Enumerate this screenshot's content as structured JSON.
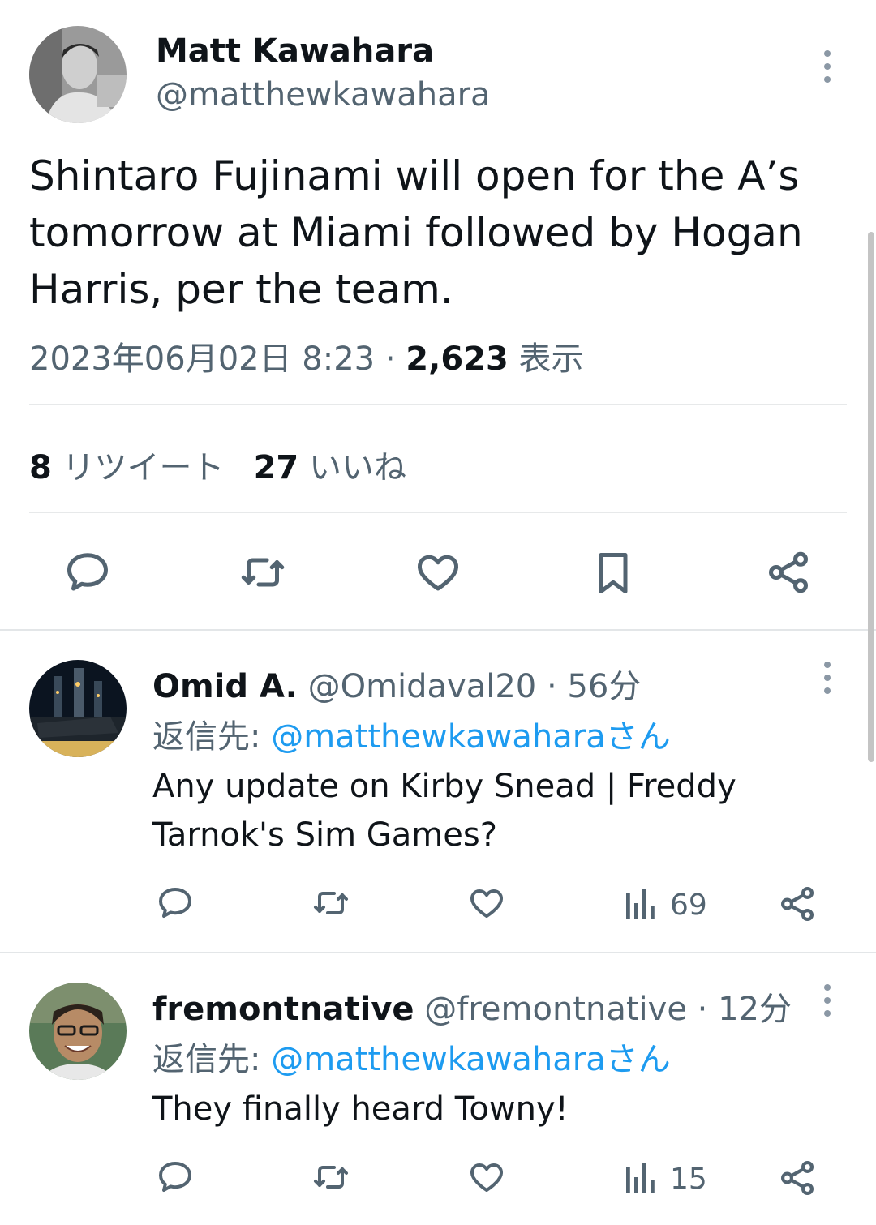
{
  "main_tweet": {
    "author_name": "Matt Kawahara",
    "author_handle": "@matthewkawahara",
    "text": "Shintaro Fujinami will open for the A’s tomorrow at Miami followed by Hogan Harris, per the team.",
    "date": "2023年06月02日 8:23",
    "separator": "·",
    "views_count": "2,623",
    "views_label": "表示",
    "retweets_count": "8",
    "retweets_label": "リツイート",
    "likes_count": "27",
    "likes_label": "いいね"
  },
  "replies": [
    {
      "name": "Omid A.",
      "handle": "@Omidaval20",
      "time": "· 56分",
      "reply_to_label": "返信先:",
      "reply_to_mention": "@matthewkawaharaさん",
      "text": "Any update on Kirby Snead | Freddy Tarnok's Sim Games?",
      "views": "69"
    },
    {
      "name": "fremontnative",
      "handle": "@fremontnative",
      "time": "· 12分",
      "reply_to_label": "返信先:",
      "reply_to_mention": "@matthewkawaharaさん",
      "text": "They finally heard Towny!",
      "views": "15"
    }
  ],
  "icons": {
    "reply": "comment-icon",
    "retweet": "retweet-icon",
    "like": "heart-icon",
    "bookmark": "bookmark-icon",
    "share": "share-icon",
    "views": "views-icon",
    "more": "more-vertical-icon"
  },
  "colors": {
    "text_primary": "#0f1419",
    "text_secondary": "#536471",
    "link": "#1d9bf0",
    "icon": "#536471"
  }
}
